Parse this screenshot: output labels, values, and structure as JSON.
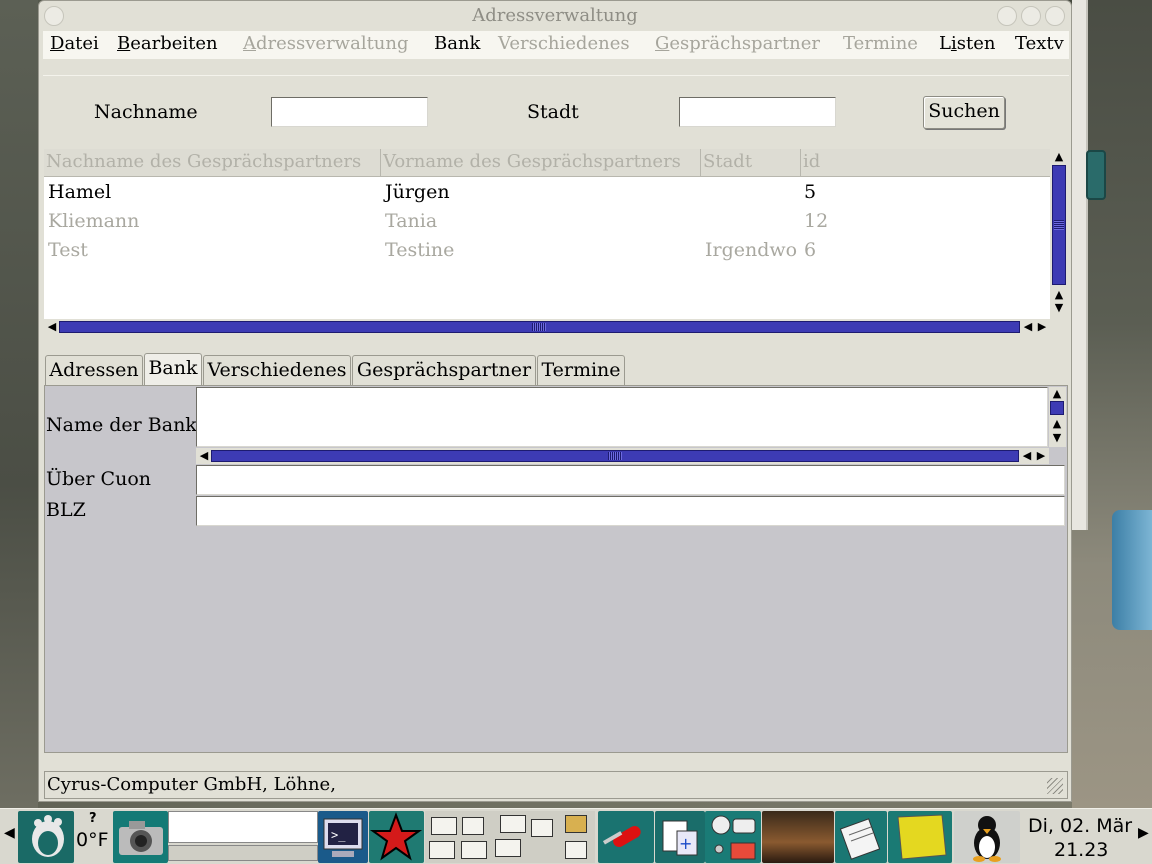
{
  "window": {
    "title": "Adressverwaltung"
  },
  "menubar": {
    "items": [
      {
        "label": "Datei",
        "u": "D",
        "rest": "atei",
        "enabled": true
      },
      {
        "label": "Bearbeiten",
        "u": "B",
        "rest": "earbeiten",
        "enabled": true
      },
      {
        "label": "Adressverwaltung",
        "u": "A",
        "rest": "dressverwaltung",
        "enabled": false
      },
      {
        "label": "Bank",
        "enabled": true
      },
      {
        "label": "Verschiedenes",
        "enabled": false
      },
      {
        "label": "Gesprächspartner",
        "u": "G",
        "rest": "esprächspartner",
        "enabled": false
      },
      {
        "label": "Termine",
        "enabled": false
      },
      {
        "label": "Listen",
        "u": "i",
        "enabled": true
      },
      {
        "label": "Textv",
        "enabled": true
      }
    ]
  },
  "search": {
    "nachname_label": "Nachname",
    "nachname_value": "",
    "stadt_label": "Stadt",
    "stadt_value": "",
    "button_label": "Suchen"
  },
  "table": {
    "columns": [
      "Nachname des Gesprächspartners",
      "Vorname des Gesprächspartners",
      "Stadt",
      "id"
    ],
    "rows": [
      {
        "nachname": "Hamel",
        "vorname": "Jürgen",
        "stadt": "",
        "id": "5",
        "active": true
      },
      {
        "nachname": "Kliemann",
        "vorname": "Tania",
        "stadt": "",
        "id": "12",
        "active": false
      },
      {
        "nachname": "Test",
        "vorname": "Testine",
        "stadt": "Irgendwo",
        "id": "6",
        "active": false
      }
    ]
  },
  "tabs": [
    {
      "label": "Adressen",
      "active": false
    },
    {
      "label": "Bank",
      "active": true
    },
    {
      "label": "Verschiedenes",
      "active": false
    },
    {
      "label": "Gesprächspartner",
      "active": false
    },
    {
      "label": "Termine",
      "active": false
    }
  ],
  "bank_form": {
    "name_label": "Name der Bank",
    "name_value": "",
    "ueber_label": "Über Cuon",
    "ueber_value": "",
    "blz_label": "BLZ",
    "blz_value": ""
  },
  "statusbar": {
    "text": "Cyrus-Computer GmbH, Löhne,"
  },
  "taskbar": {
    "weather_question": "?",
    "weather_temp": "0°F",
    "clock_date": "Di, 02. Mär",
    "clock_time": "21.23",
    "icons": [
      "gnome-foot-icon",
      "camera-icon",
      "terminal-icon",
      "star-icon",
      "swiss-knife-icon",
      "network-icon",
      "search-icon",
      "nebula-icon",
      "notepad-icon",
      "sticky-note-icon",
      "tux-icon"
    ]
  }
}
